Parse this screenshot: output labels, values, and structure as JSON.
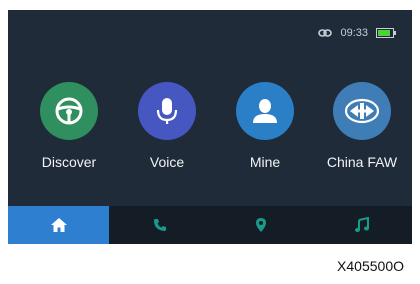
{
  "status_bar": {
    "link_icon": "link-icon",
    "time": "09:33",
    "battery_icon": "battery-icon"
  },
  "apps": [
    {
      "label": "Discover",
      "icon": "steering-wheel-icon",
      "color": "#2f8f5f"
    },
    {
      "label": "Voice",
      "icon": "microphone-icon",
      "color": "#4657c2"
    },
    {
      "label": "Mine",
      "icon": "user-icon",
      "color": "#2a7fc6"
    },
    {
      "label": "China FAW",
      "icon": "faw-logo-icon",
      "color": "#3f7db6"
    }
  ],
  "navbar": {
    "tabs": [
      {
        "icon": "home-icon",
        "active": true
      },
      {
        "icon": "phone-icon",
        "active": false
      },
      {
        "icon": "map-pin-icon",
        "active": false
      },
      {
        "icon": "music-icon",
        "active": false
      }
    ],
    "active_color": "#2f7fd0",
    "icon_color": "#1a9a8a"
  },
  "figure_code": "X405500O"
}
